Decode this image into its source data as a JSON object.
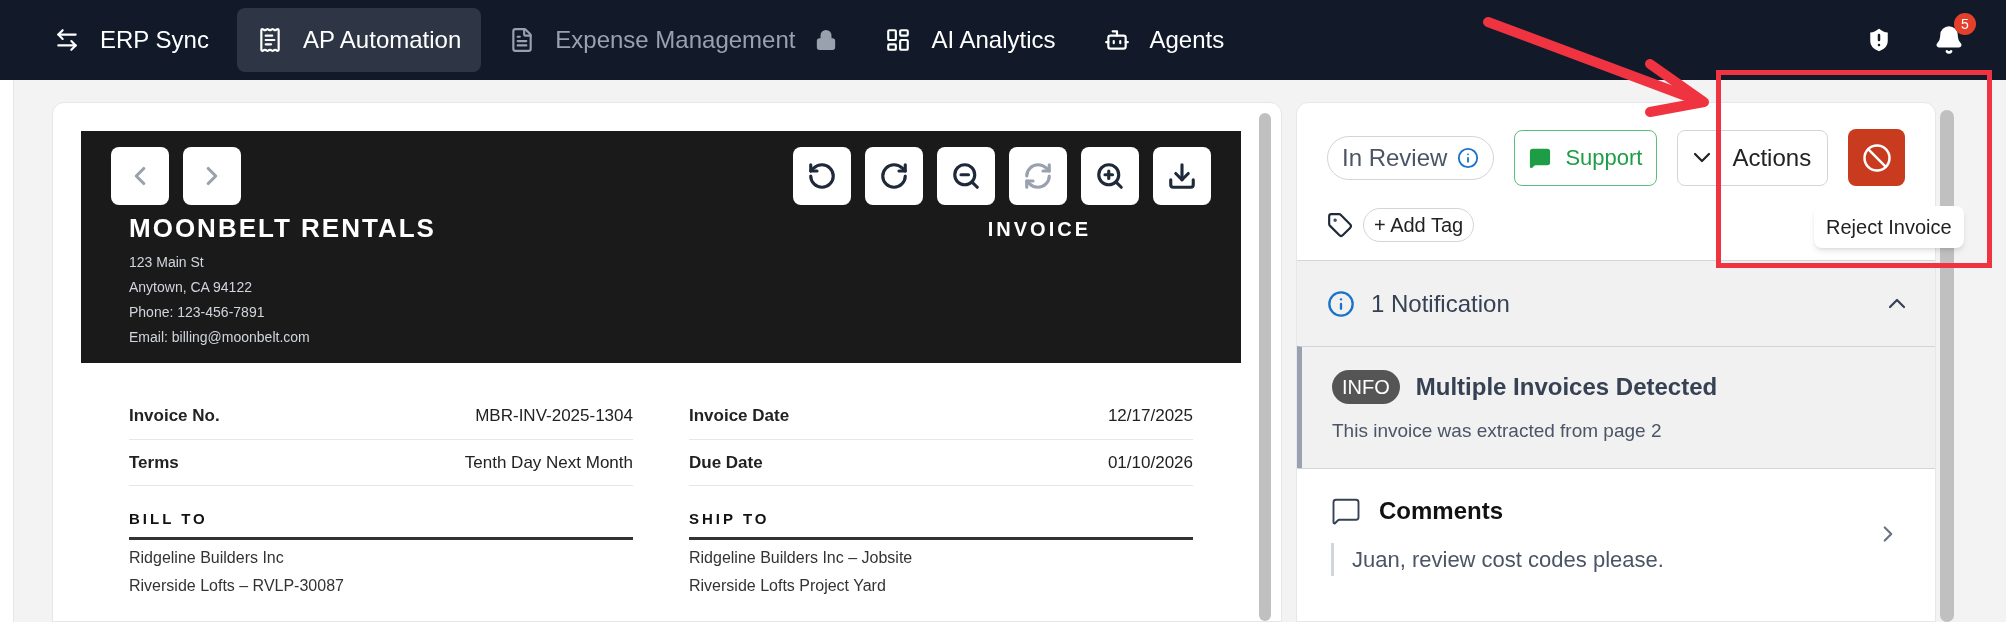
{
  "nav": {
    "items": [
      {
        "label": "ERP Sync",
        "selected": false,
        "disabled": false
      },
      {
        "label": "AP Automation",
        "selected": true,
        "disabled": false
      },
      {
        "label": "Expense Management",
        "selected": false,
        "disabled": true
      },
      {
        "label": "AI Analytics",
        "selected": false,
        "disabled": false
      },
      {
        "label": "Agents",
        "selected": false,
        "disabled": false
      }
    ],
    "notification_count": "5"
  },
  "document": {
    "company": "MOONBELT RENTALS",
    "doc_title": "INVOICE",
    "address": [
      "123 Main St",
      "Anytown, CA 94122",
      "Phone: 123-456-7891",
      "Email: billing@moonbelt.com"
    ],
    "fields": [
      [
        {
          "label": "Invoice No.",
          "value": "MBR-INV-2025-1304"
        },
        {
          "label": "Terms",
          "value": "Tenth Day Next Month"
        }
      ],
      [
        {
          "label": "Invoice Date",
          "value": "12/17/2025"
        },
        {
          "label": "Due Date",
          "value": "01/10/2026"
        }
      ]
    ],
    "parties": [
      {
        "heading": "BILL TO",
        "lines": [
          "Ridgeline Builders Inc",
          "Riverside Lofts – RVLP-30087"
        ]
      },
      {
        "heading": "SHIP TO",
        "lines": [
          "Ridgeline Builders Inc – Jobsite",
          "Riverside Lofts Project Yard"
        ]
      }
    ]
  },
  "panel": {
    "status": "In Review",
    "support": "Support",
    "actions": "Actions",
    "tooltip": "Reject Invoice",
    "add_tag": "+ Add Tag",
    "notifications": {
      "title": "1 Notification",
      "expanded": true,
      "items": [
        {
          "badge": "INFO",
          "title": "Multiple Invoices Detected",
          "message": "This invoice was extracted from page 2"
        }
      ]
    },
    "comments": {
      "title": "Comments",
      "preview": "Juan, review cost codes please."
    }
  }
}
